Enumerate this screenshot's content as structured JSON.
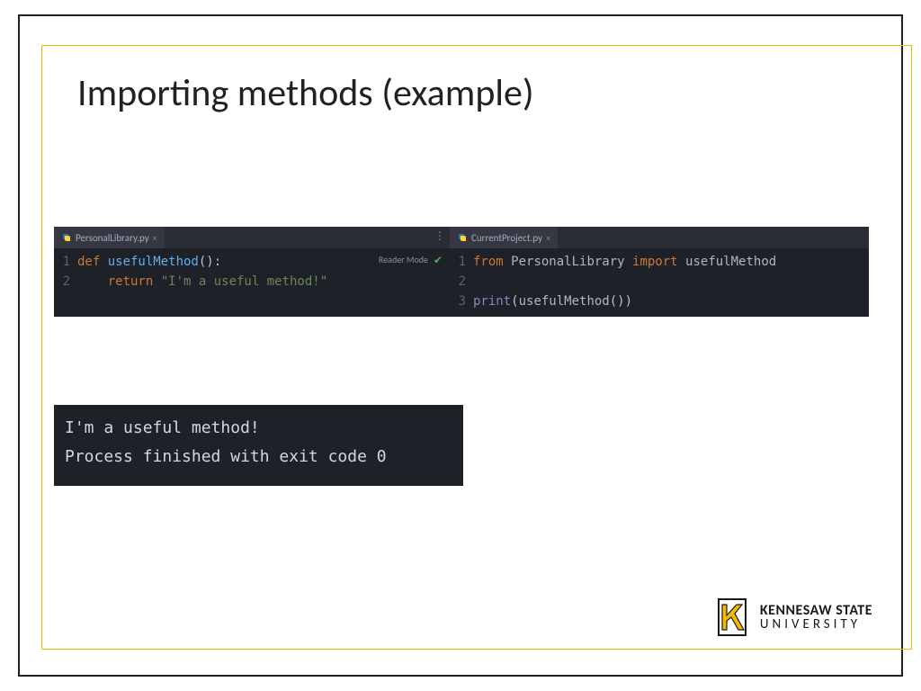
{
  "title": "Importing methods (example)",
  "editor": {
    "left": {
      "tab_name": "PersonalLibrary.py",
      "reader_mode_label": "Reader Mode",
      "lines": [
        {
          "num": "1",
          "tokens": [
            "def ",
            "usefulMethod",
            "():"
          ]
        },
        {
          "num": "2",
          "tokens": [
            "    return ",
            "\"I'm a useful method!\""
          ]
        }
      ]
    },
    "right": {
      "tab_name": "CurrentProject.py",
      "lines": [
        {
          "num": "1",
          "tokens": [
            "from ",
            "PersonalLibrary ",
            "import ",
            "usefulMethod"
          ]
        },
        {
          "num": "2",
          "tokens": [
            ""
          ]
        },
        {
          "num": "3",
          "tokens": [
            "print",
            "(",
            "usefulMethod",
            "())"
          ]
        }
      ]
    }
  },
  "console": {
    "output_line": "I'm a useful method!",
    "blank": "",
    "exit_line": "Process finished with exit code 0"
  },
  "footer": {
    "line1": "KENNESAW STATE",
    "line2": "UNIVERSITY"
  }
}
